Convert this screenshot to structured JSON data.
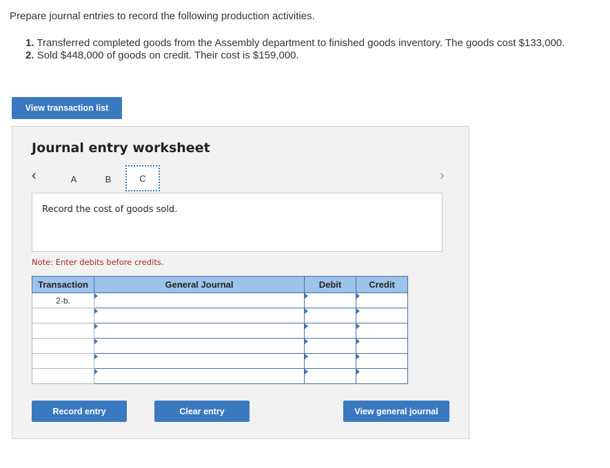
{
  "prompt": "Prepare journal entries to record the following production activities.",
  "steps": [
    {
      "num": "1.",
      "text": "Transferred completed goods from the Assembly department to finished goods inventory. The goods cost $133,000."
    },
    {
      "num": "2.",
      "text": "Sold $448,000 of goods on credit. Their cost is $159,000."
    }
  ],
  "view_transaction_list": "View transaction list",
  "worksheet": {
    "title": "Journal entry worksheet",
    "tabs": [
      "A",
      "B",
      "C"
    ],
    "active_tab": "C",
    "description": "Record the cost of goods sold.",
    "note": "Note: Enter debits before credits.",
    "columns": [
      "Transaction",
      "General Journal",
      "Debit",
      "Credit"
    ],
    "rows": [
      {
        "transaction": "2-b.",
        "account": "",
        "debit": "",
        "credit": ""
      },
      {
        "transaction": "",
        "account": "",
        "debit": "",
        "credit": ""
      },
      {
        "transaction": "",
        "account": "",
        "debit": "",
        "credit": ""
      },
      {
        "transaction": "",
        "account": "",
        "debit": "",
        "credit": ""
      },
      {
        "transaction": "",
        "account": "",
        "debit": "",
        "credit": ""
      },
      {
        "transaction": "",
        "account": "",
        "debit": "",
        "credit": ""
      }
    ],
    "buttons": {
      "record": "Record entry",
      "clear": "Clear entry",
      "view_journal": "View general journal"
    }
  }
}
